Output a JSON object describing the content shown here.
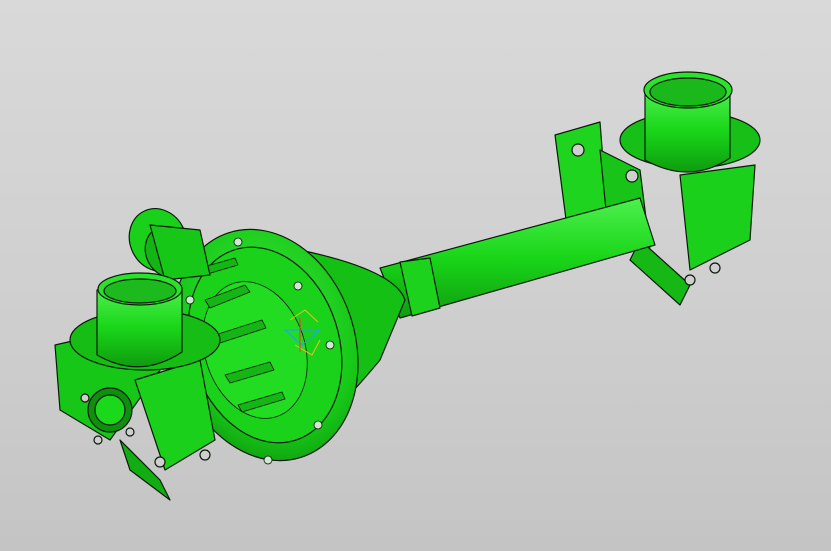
{
  "viewport": {
    "background_top": "#d9d9d9",
    "background_bottom": "#c4c4c4",
    "model_color": "#19d619",
    "model_dark": "#0f9c0f",
    "model_light": "#4ef04e",
    "edge_color": "#0a1a0a"
  },
  "model": {
    "icon": "axle-housing-3d-model-icon",
    "parts": [
      "left-hub-flange",
      "left-spring-pad",
      "left-axle-tube-stub",
      "differential-housing",
      "right-axle-tube",
      "right-spring-pad",
      "right-axle-tube-stub",
      "pinion-flange"
    ]
  },
  "triad": {
    "icon": "coordinate-triad-icon",
    "x_color": "#e8c020",
    "y_color": "#1ea0ff",
    "z_color": "#ff3030"
  }
}
